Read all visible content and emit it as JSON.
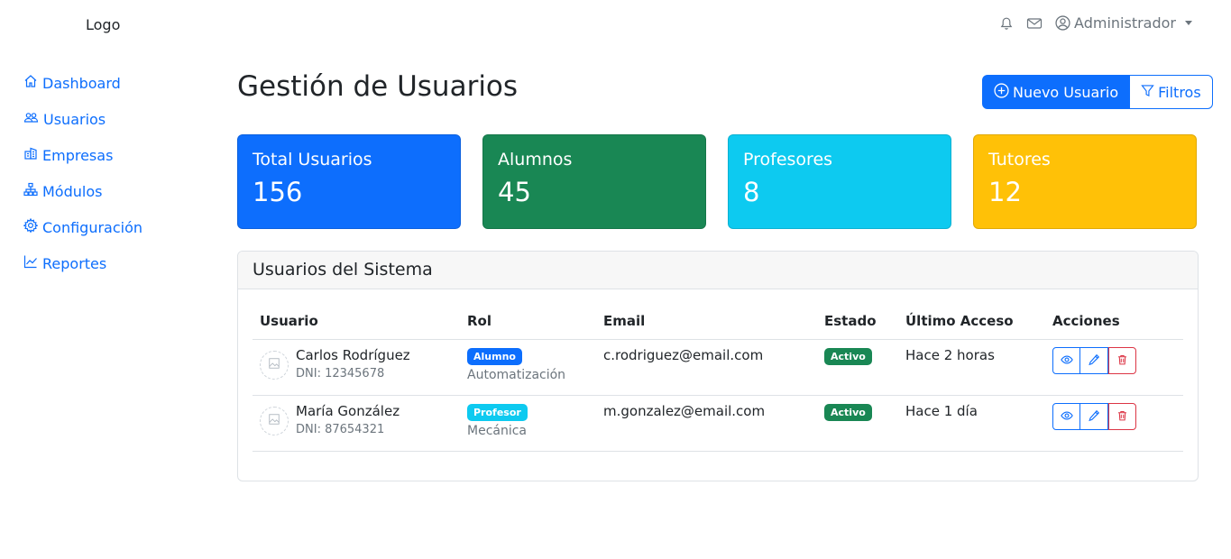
{
  "header": {
    "logo": "Logo",
    "user_label": "Administrador"
  },
  "sidebar": {
    "items": [
      {
        "label": "Dashboard",
        "icon": "house-icon"
      },
      {
        "label": "Usuarios",
        "icon": "people-icon"
      },
      {
        "label": "Empresas",
        "icon": "building-icon"
      },
      {
        "label": "Módulos",
        "icon": "diagram-icon"
      },
      {
        "label": "Configuración",
        "icon": "gear-icon"
      },
      {
        "label": "Reportes",
        "icon": "graph-icon"
      }
    ]
  },
  "main": {
    "title": "Gestión de Usuarios",
    "new_user_label": "Nuevo Usuario",
    "filters_label": "Filtros"
  },
  "stats": [
    {
      "title": "Total Usuarios",
      "value": "156",
      "color": "#0d6efd"
    },
    {
      "title": "Alumnos",
      "value": "45",
      "color": "#198754"
    },
    {
      "title": "Profesores",
      "value": "8",
      "color": "#0dcaf0"
    },
    {
      "title": "Tutores",
      "value": "12",
      "color": "#ffc107"
    }
  ],
  "table": {
    "title": "Usuarios del Sistema",
    "columns": [
      "Usuario",
      "Rol",
      "Email",
      "Estado",
      "Último Acceso",
      "Acciones"
    ],
    "rows": [
      {
        "name": "Carlos Rodríguez",
        "dni": "DNI: 12345678",
        "role": "Alumno",
        "role_color": "#0d6efd",
        "specialty": "Automatización",
        "email": "c.rodriguez@email.com",
        "status": "Activo",
        "last_access": "Hace 2 horas"
      },
      {
        "name": "María González",
        "dni": "DNI: 87654321",
        "role": "Profesor",
        "role_color": "#0dcaf0",
        "specialty": "Mecánica",
        "email": "m.gonzalez@email.com",
        "status": "Activo",
        "last_access": "Hace 1 día"
      }
    ]
  },
  "colors": {
    "primary": "#0d6efd",
    "success": "#198754",
    "info": "#0dcaf0",
    "warning": "#ffc107",
    "danger": "#dc3545"
  }
}
